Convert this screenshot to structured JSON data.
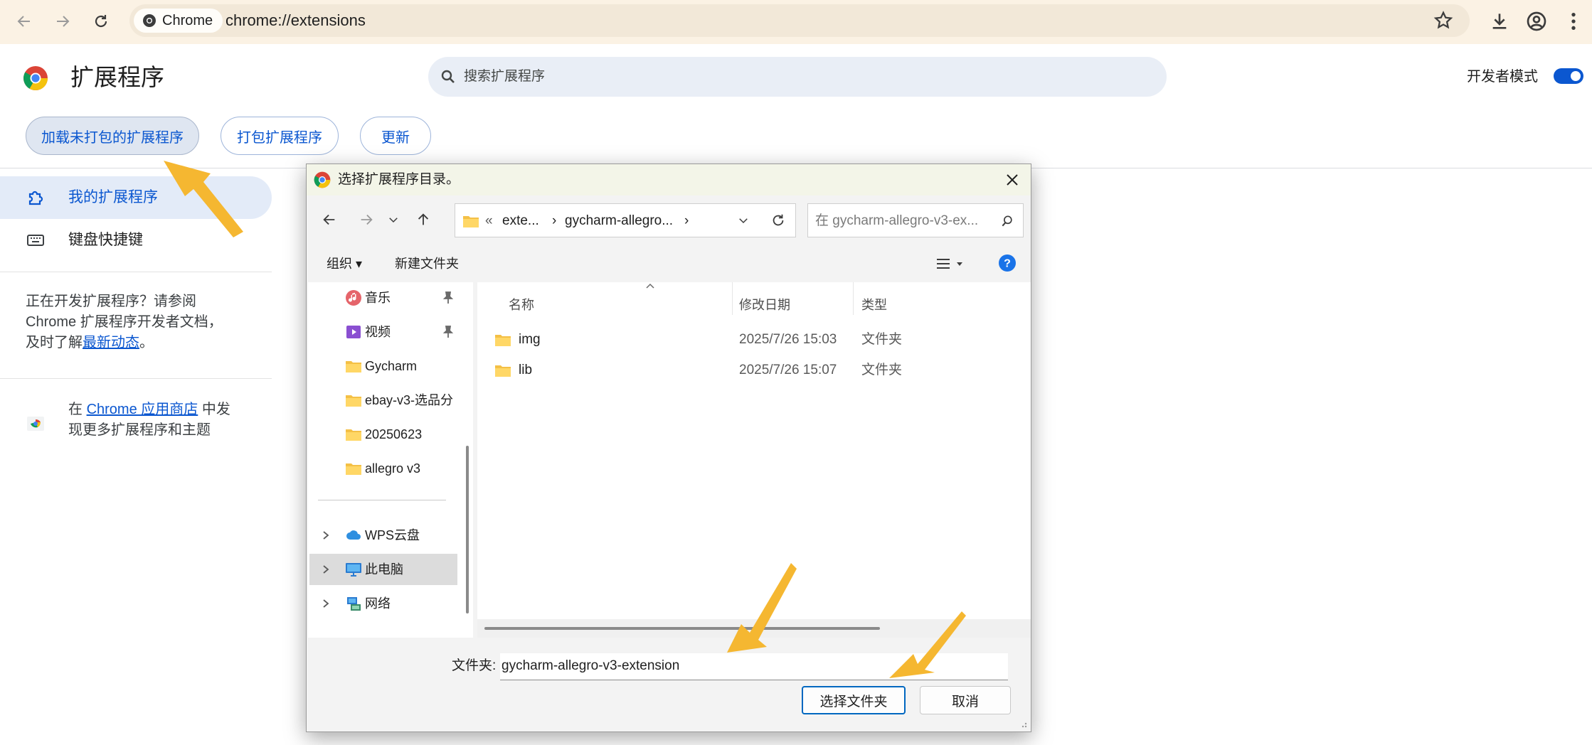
{
  "browser": {
    "chip_label": "Chrome",
    "url": "chrome://extensions"
  },
  "header": {
    "title": "扩展程序",
    "search_placeholder": "搜索扩展程序",
    "dev_mode_label": "开发者模式",
    "dev_mode_on": true
  },
  "actions": {
    "load_unpacked": "加载未打包的扩展程序",
    "pack": "打包扩展程序",
    "update": "更新"
  },
  "sidebar": {
    "items": [
      {
        "label": "我的扩展程序",
        "active": true
      },
      {
        "label": "键盘快捷键",
        "active": false
      }
    ],
    "dev_text_1": "正在开发扩展程序？请参阅",
    "dev_text_2": "Chrome 扩展程序开发者文档，",
    "dev_text_3_pre": "及时了解",
    "dev_text_3_link": "最新动态",
    "dev_text_3_post": "。",
    "store_pre": "在 ",
    "store_link": "Chrome 应用商店",
    "store_post": " 中发",
    "store_line2": "现更多扩展程序和主题"
  },
  "dialog": {
    "title": "选择扩展程序目录。",
    "breadcrumb": [
      "«",
      "exte...",
      "›",
      "gycharm-allegro...",
      "›"
    ],
    "search_placeholder": "在 gycharm-allegro-v3-ex...",
    "organize": "组织 ▾",
    "new_folder": "新建文件夹",
    "nav": [
      {
        "label": "音乐",
        "icon": "music-icon",
        "pinned": true
      },
      {
        "label": "视频",
        "icon": "video-icon",
        "pinned": true
      },
      {
        "label": "Gycharm",
        "icon": "folder-icon",
        "pinned": false
      },
      {
        "label": "ebay-v3-选品分",
        "icon": "folder-icon",
        "pinned": false
      },
      {
        "label": "20250623",
        "icon": "folder-icon",
        "pinned": false
      },
      {
        "label": "allegro v3",
        "icon": "folder-icon",
        "pinned": false
      }
    ],
    "nav_roots": [
      {
        "label": "WPS云盘",
        "icon": "cloud-icon",
        "selected": false
      },
      {
        "label": "此电脑",
        "icon": "computer-icon",
        "selected": true
      },
      {
        "label": "网络",
        "icon": "network-icon",
        "selected": false
      }
    ],
    "columns": {
      "name": "名称",
      "date": "修改日期",
      "type": "类型"
    },
    "files": [
      {
        "name": "img",
        "date": "2025/7/26 15:03",
        "type": "文件夹"
      },
      {
        "name": "lib",
        "date": "2025/7/26 15:07",
        "type": "文件夹"
      }
    ],
    "folder_label": "文件夹:",
    "folder_value": "gycharm-allegro-v3-extension",
    "select_button": "选择文件夹",
    "cancel_button": "取消"
  },
  "colors": {
    "accent": "#0b57d0",
    "annotation_arrow": "#f5b731"
  }
}
